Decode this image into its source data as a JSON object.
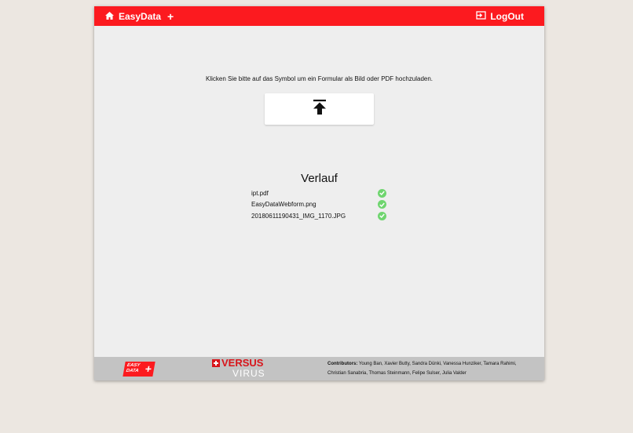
{
  "app": {
    "title": "EasyData"
  },
  "header": {
    "logout_label": "LogOut"
  },
  "upload": {
    "instruction": "Klicken Sie bitte auf das Symbol um ein Formular als Bild oder PDF hochzuladen."
  },
  "history": {
    "title": "Verlauf",
    "items": [
      {
        "name": "ipt.pdf",
        "status": "success"
      },
      {
        "name": "EasyDataWebform.png",
        "status": "success"
      },
      {
        "name": "20180611190431_IMG_1170.JPG",
        "status": "success"
      }
    ]
  },
  "footer": {
    "easy_logo": {
      "line1": "EASY",
      "line2": "DATA"
    },
    "versus_logo": {
      "top": "VERSUS",
      "bottom": "VIRUS"
    },
    "contributors_label": "Contributors:",
    "contributors_text": "Young Ban, Xavier Butty, Sandra Dünki, Vanessa Hunziker, Tamara Rahimi, Christian Sanabria, Thomas Steinmann, Felipe Sulser, Julia Valder"
  },
  "icons": {
    "home": "home-icon",
    "add": "plus-icon",
    "logout": "logout-icon",
    "upload": "upload-icon",
    "check": "check-circle-icon"
  },
  "colors": {
    "brand_red": "#fc1a1f",
    "success_green": "#6fd56f",
    "page_bg": "#ece7e1",
    "panel_bg": "#eeeeee",
    "footer_bg": "#c3c3c3"
  }
}
